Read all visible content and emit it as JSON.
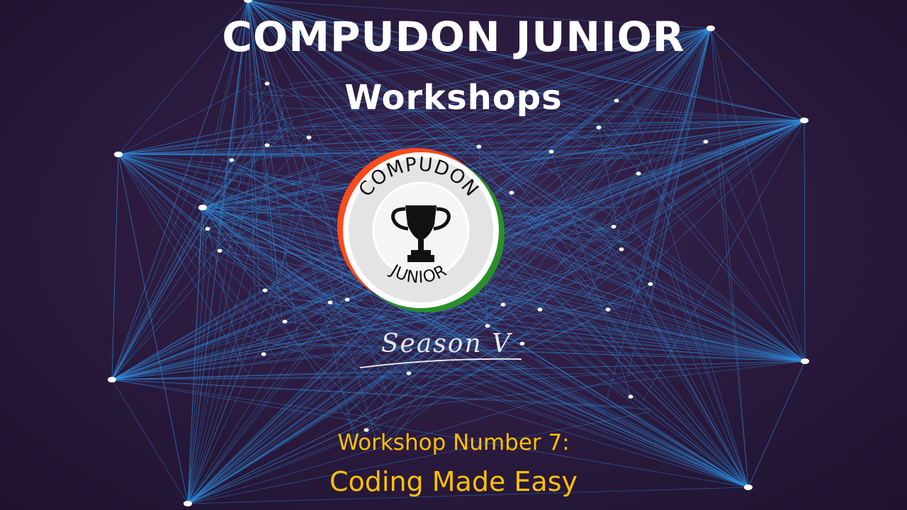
{
  "slide": {
    "title": "COMPUDON JUNIOR",
    "subtitle": "Workshops",
    "workshop_number": "Workshop Number 7:",
    "workshop_topic": "Coding Made Easy"
  },
  "logo": {
    "top_text": "COMPUDON",
    "bottom_text": "JUNIOR",
    "icon": "trophy-icon",
    "colors": {
      "saffron": "#ff4a1c",
      "green": "#2a8f2a",
      "ring": "#e8e8e8",
      "text": "#111111"
    }
  },
  "season": {
    "text": "Season V"
  },
  "colors": {
    "background": "#2a1a3d",
    "lines": "#2f8fe0",
    "title": "#ffffff",
    "accent": "#ffc000"
  }
}
